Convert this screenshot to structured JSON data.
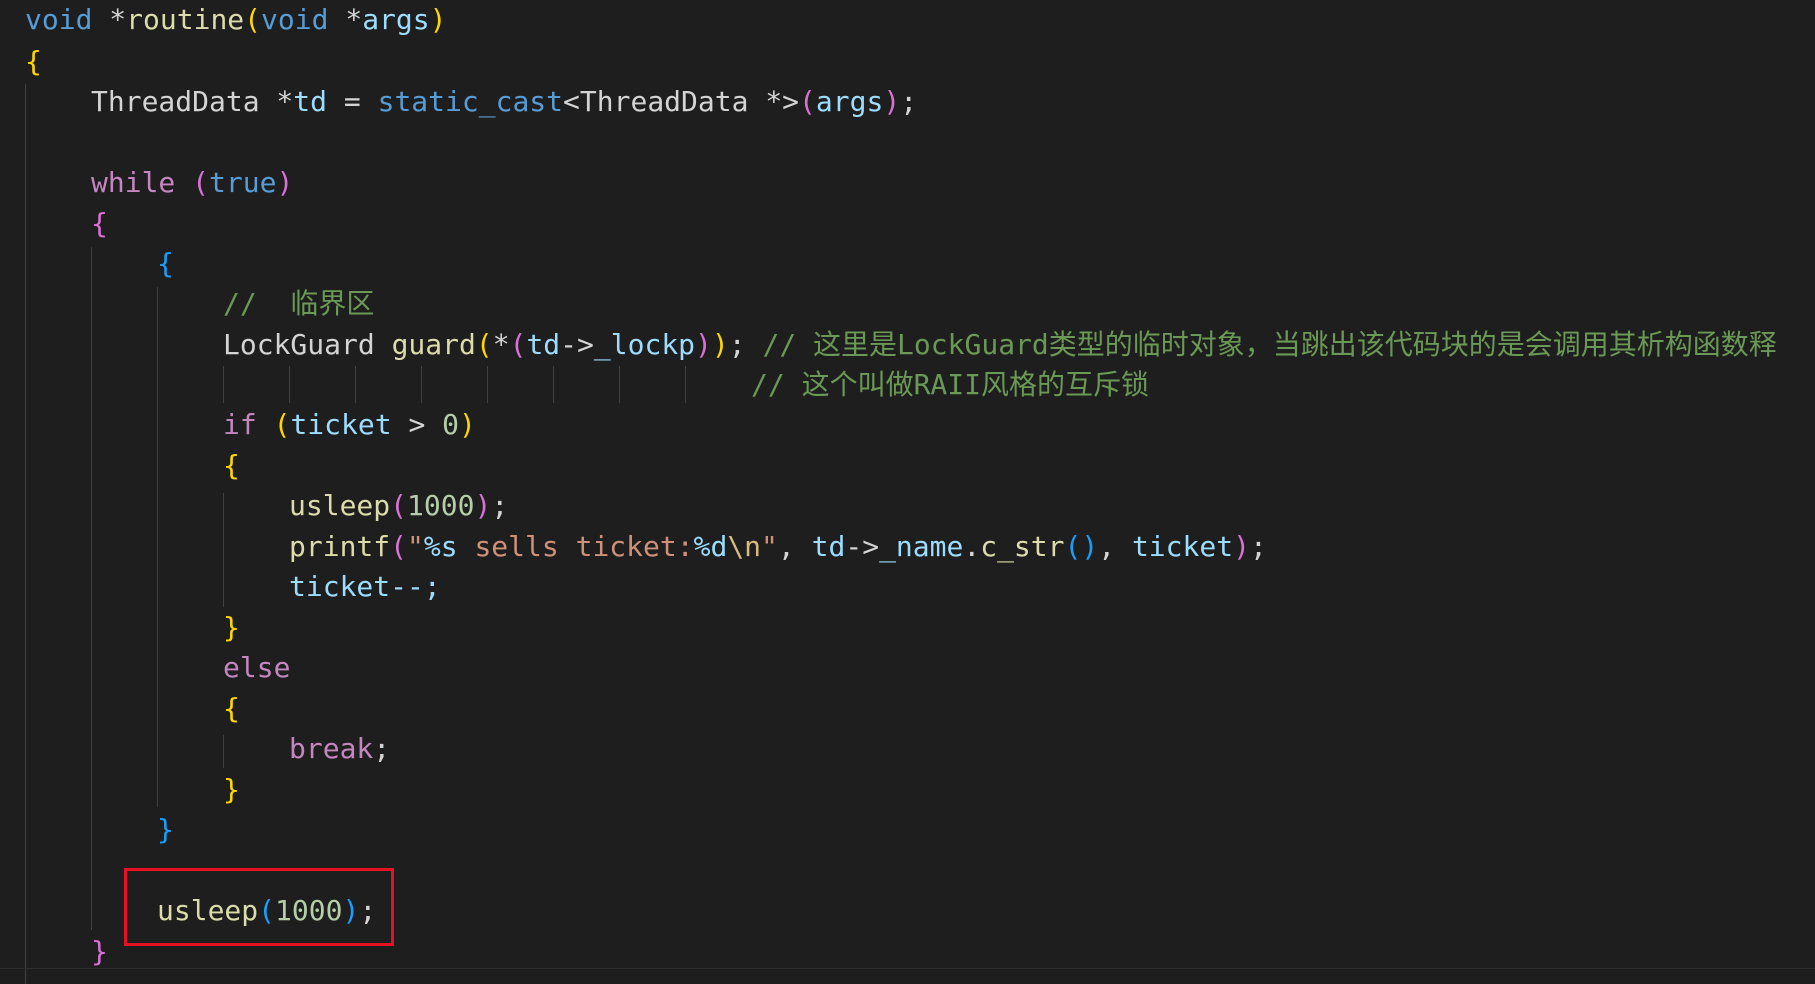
{
  "theme": {
    "background": "#1e1e1e",
    "keyword": "#569cd6",
    "control": "#c586c0",
    "function": "#dcdcaa",
    "variable": "#9cdcfe",
    "number": "#b5cea8",
    "string": "#ce9178",
    "comment": "#6a9955",
    "bracket_level_1": "#ffd700",
    "bracket_level_2": "#da70d6",
    "bracket_level_3": "#179fff",
    "highlight_border": "#e81123"
  },
  "code": {
    "l1": {
      "void1": "void",
      "star1": " *",
      "fn": "routine",
      "p1": "(",
      "void2": "void",
      "star2": " *",
      "args": "args",
      "p2": ")"
    },
    "l2": {
      "brace": "{"
    },
    "l3": {
      "type": "ThreadData *",
      "td": "td",
      "eq": " = ",
      "cast": "static_cast",
      "tmpl": "<ThreadData *>",
      "p1": "(",
      "args": "args",
      "p2": ")",
      "semi": ";"
    },
    "l5": {
      "kw": "while",
      "sp": " ",
      "p1": "(",
      "val": "true",
      "p2": ")"
    },
    "l6": {
      "brace": "{"
    },
    "l7": {
      "brace": "{"
    },
    "l8": {
      "comment": "//  临界区"
    },
    "l9": {
      "type": "LockGuard ",
      "fn": "guard",
      "p1": "(",
      "deref": "*",
      "p2": "(",
      "td": "td",
      "arrow": "->",
      "lockp": "_lockp",
      "p3": ")",
      "p4": ")",
      "semi": "; ",
      "comment": "// 这里是LockGuard类型的临时对象，当跳出该代码块的是会调用其析构函数释"
    },
    "l10": {
      "comment": "// 这个叫做RAII风格的互斥锁"
    },
    "l11": {
      "kw": "if",
      "sp": " ",
      "p1": "(",
      "ticket": "ticket",
      "gt": " > ",
      "num": "0",
      "p2": ")"
    },
    "l12": {
      "brace": "{"
    },
    "l13": {
      "fn": "usleep",
      "p1": "(",
      "num": "1000",
      "p2": ")",
      "semi": ";"
    },
    "l14": {
      "fn": "printf",
      "p1": "(",
      "q1": "\"",
      "fmt1": "%s",
      "text": " sells ticket:",
      "fmt2": "%d",
      "esc": "\\n",
      "q2": "\"",
      "comma1": ", ",
      "td": "td",
      "arrow": "->",
      "name": "_name",
      "dot": ".",
      "cstr": "c_str",
      "p2": "(",
      "p3": ")",
      "comma2": ", ",
      "ticket": "ticket",
      "p4": ")",
      "semi": ";"
    },
    "l15": {
      "text": "ticket--;"
    },
    "l16": {
      "brace": "}"
    },
    "l17": {
      "kw": "else"
    },
    "l18": {
      "brace": "{"
    },
    "l19": {
      "kw": "break",
      "semi": ";"
    },
    "l20": {
      "brace": "}"
    },
    "l21": {
      "brace": "}"
    },
    "l23": {
      "fn": "usleep",
      "p1": "(",
      "num": "1000",
      "p2": ")",
      "semi": ";"
    },
    "l24": {
      "brace": "}"
    }
  }
}
